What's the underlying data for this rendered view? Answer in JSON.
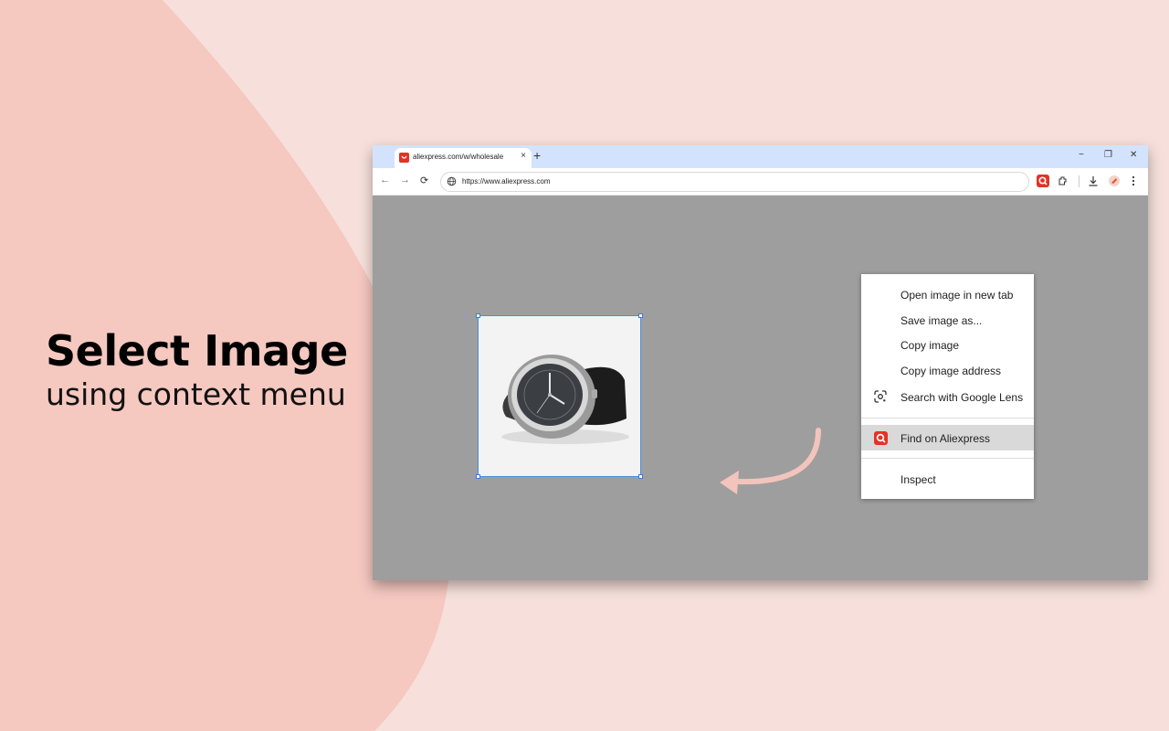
{
  "headline": {
    "title": "Select Image",
    "subtitle": "using context menu"
  },
  "browser": {
    "tab_title": "aliexpress.com/w/wholesale",
    "tab_close": "×",
    "new_tab": "+",
    "window_controls": [
      "−",
      "❐",
      "✕"
    ],
    "url": "https://www.aliexpress.com",
    "nav": {
      "back": "←",
      "forward": "→",
      "reload": "⟳"
    },
    "icons": [
      "aliexpress-extension-icon",
      "extensions-icon",
      "download-icon",
      "profile-icon",
      "more-menu-icon"
    ]
  },
  "context_menu": {
    "items": [
      {
        "label": "Open image in new tab"
      },
      {
        "label": "Save image as..."
      },
      {
        "label": "Copy image"
      },
      {
        "label": "Copy image address"
      },
      {
        "label": "Search with Google Lens"
      },
      {
        "label": "Find on Aliexpress"
      },
      {
        "label": "Inspect"
      }
    ]
  },
  "colors": {
    "background": "#f7e0db",
    "blob": "#f5c8c0",
    "accent_red": "#e43225",
    "arrow": "#f3c4bb",
    "page_gray": "#9e9e9e",
    "highlight": "#d9d9d9"
  }
}
